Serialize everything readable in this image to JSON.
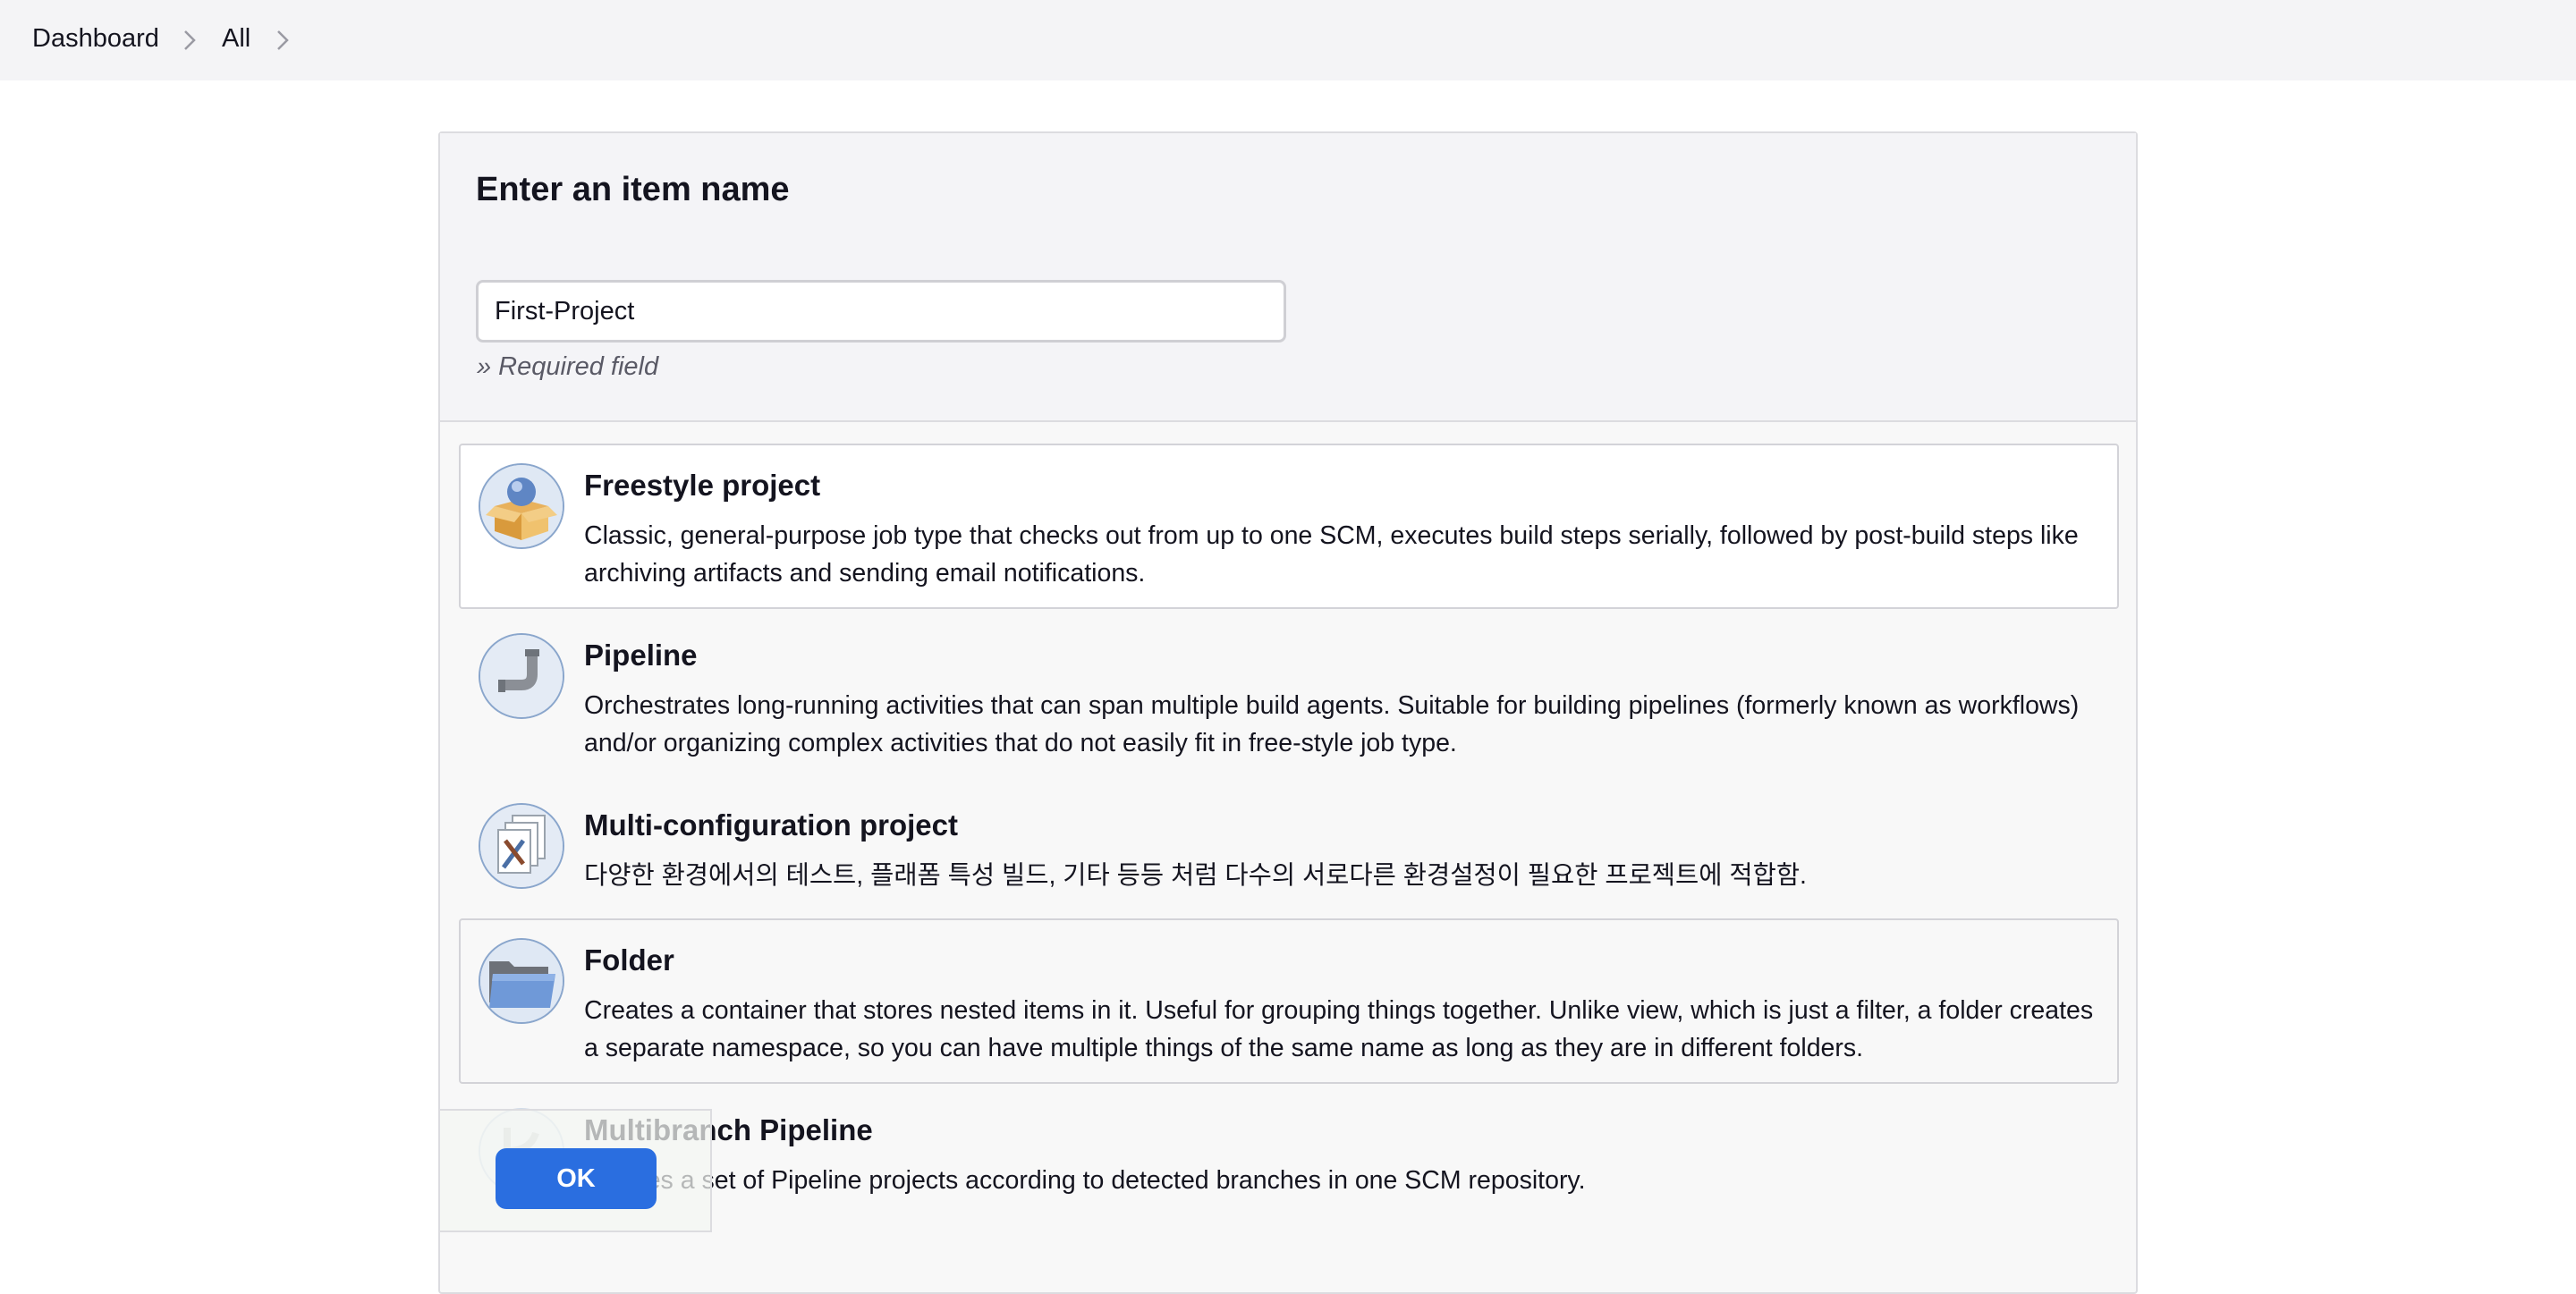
{
  "breadcrumb": {
    "items": [
      {
        "label": "Dashboard"
      },
      {
        "label": "All"
      }
    ]
  },
  "form": {
    "title": "Enter an item name",
    "item_name_value": "First-Project",
    "required_hint": "» Required field"
  },
  "item_types": [
    {
      "name": "Freestyle project",
      "description": "Classic, general-purpose job type that checks out from up to one SCM, executes build steps serially, followed by post-build steps like archiving artifacts and sending email notifications.",
      "icon": "freestyle-box-icon"
    },
    {
      "name": "Pipeline",
      "description": "Orchestrates long-running activities that can span multiple build agents. Suitable for building pipelines (formerly known as workflows) and/or organizing complex activities that do not easily fit in free-style job type.",
      "icon": "pipe-icon"
    },
    {
      "name": "Multi-configuration project",
      "description": "다양한 환경에서의 테스트, 플래폼 특성 빌드, 기타 등등 처럼 다수의 서로다른 환경설정이 필요한 프로젝트에 적합함.",
      "icon": "documents-tools-icon"
    },
    {
      "name": "Folder",
      "description": "Creates a container that stores nested items in it. Useful for grouping things together. Unlike view, which is just a filter, a folder creates a separate namespace, so you can have multiple things of the same name as long as they are in different folders.",
      "icon": "folder-icon"
    },
    {
      "name": "Multibranch Pipeline",
      "description": "Creates a set of Pipeline projects according to detected branches in one SCM repository.",
      "icon": "multibranch-icon"
    }
  ],
  "footer": {
    "ok_label": "OK"
  },
  "colors": {
    "accent": "#2a6ee0",
    "topbar": "#f4f4f6",
    "panel_border": "#dcdce0"
  }
}
